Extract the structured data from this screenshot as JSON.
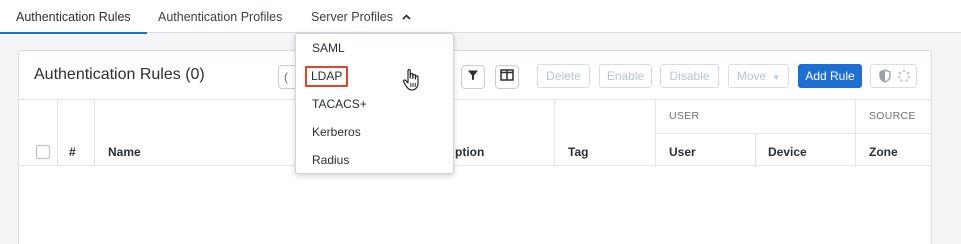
{
  "tabs": [
    {
      "label": "Authentication Rules",
      "active": true
    },
    {
      "label": "Authentication Profiles",
      "active": false
    },
    {
      "label": "Server Profiles",
      "active": false,
      "icon": "chevron-up-icon"
    }
  ],
  "panel": {
    "title": "Authentication Rules (0)"
  },
  "toolbar": {
    "delete_label": "Delete",
    "enable_label": "Enable",
    "disable_label": "Disable",
    "move_label": "Move",
    "add_rule_label": "Add Rule",
    "filter_icon": "filter-icon",
    "columns_icon": "columns-icon",
    "shield_icon": "shield-icon",
    "spinner_icon": "loading-icon"
  },
  "table": {
    "group_headers": [
      "USER",
      "SOURCE"
    ],
    "columns": [
      "#",
      "Name",
      "ption",
      "Tag",
      "User",
      "Device",
      "Zone"
    ]
  },
  "dropdown": {
    "items": [
      "SAML",
      "LDAP",
      "TACACS+",
      "Kerberos",
      "Radius"
    ],
    "highlighted": "LDAP"
  },
  "colors": {
    "accent": "#1f6fd0",
    "highlight_border": "#e0452b"
  }
}
